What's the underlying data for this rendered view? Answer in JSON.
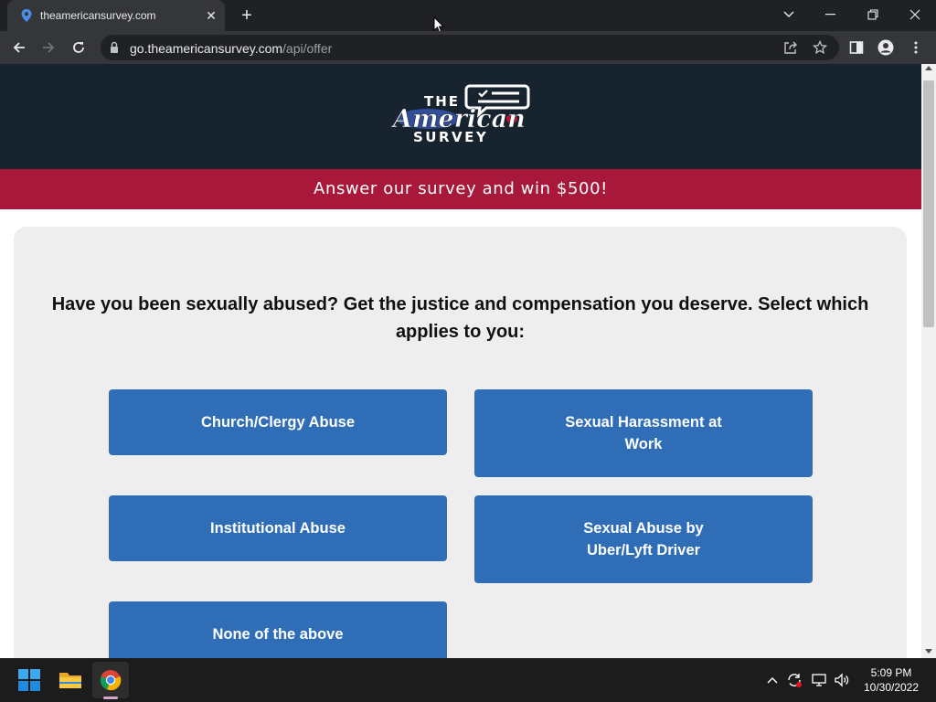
{
  "browser": {
    "tab": {
      "title": "theamericansurvey.com",
      "favicon": "location-pin-icon"
    },
    "url": {
      "host": "go.theamericansurvey.com",
      "path": "/api/offer"
    }
  },
  "site": {
    "logo": {
      "top": "THE",
      "script": "American",
      "bottom": "SURVEY"
    },
    "banner": "Answer our survey and win $500!",
    "question": "Have you been sexually abused? Get the justice and compensation you deserve. Select which applies to you:",
    "options": [
      "Church/Clergy Abuse",
      "Sexual Harassment at Work",
      "Institutional Abuse",
      "Sexual Abuse by Uber/Lyft Driver",
      "None of the above"
    ]
  },
  "taskbar": {
    "time": "5:09 PM",
    "date": "10/30/2022",
    "apps": [
      "windows-start-icon",
      "file-explorer-icon",
      "chrome-icon"
    ]
  },
  "colors": {
    "header": "#17242f",
    "banner": "#a8183a",
    "button": "#2f6db7",
    "card": "#efeeef"
  }
}
